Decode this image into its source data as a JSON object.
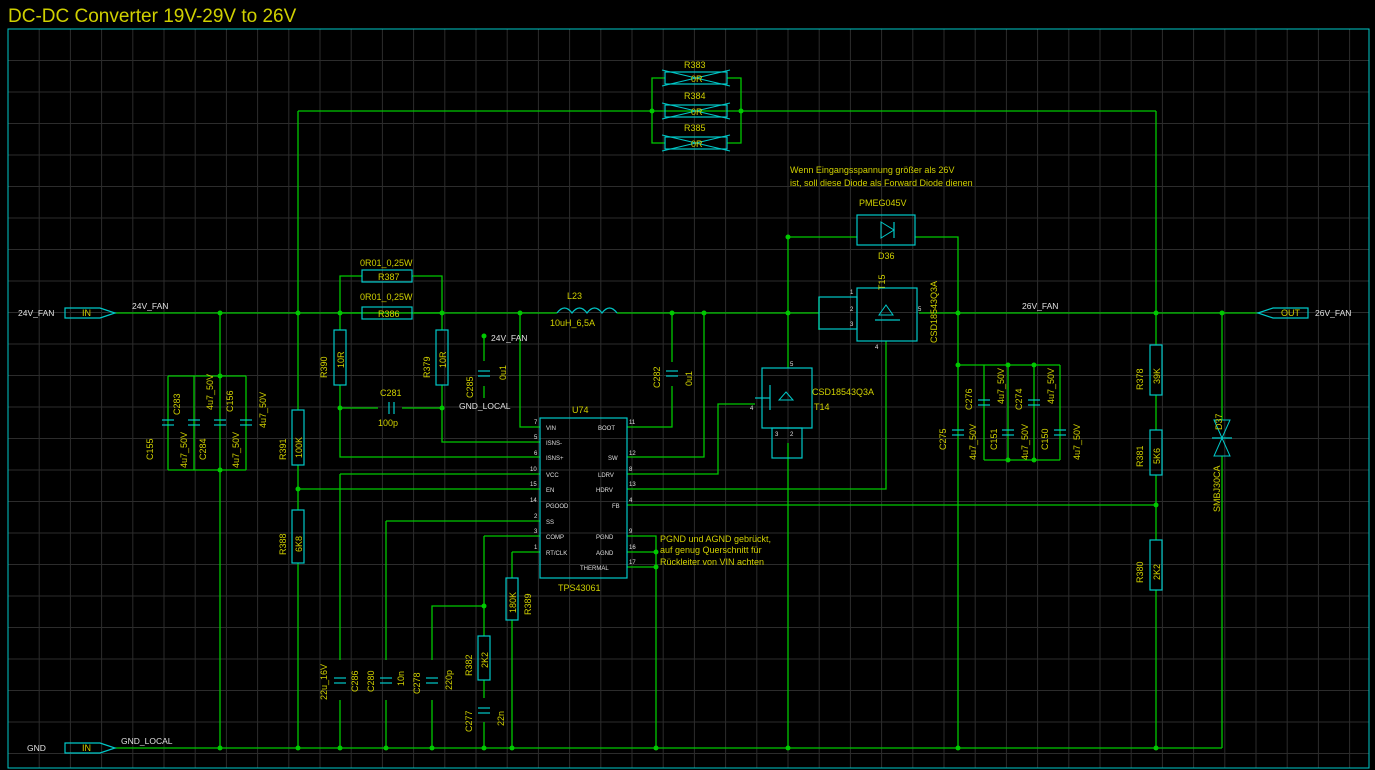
{
  "title": "DC-DC Converter 19V-29V to 26V",
  "ports": {
    "in_24v_tag": "IN",
    "in_24v_name": "24V_FAN",
    "gnd_tag": "IN",
    "gnd_name": "GND",
    "out_26v_tag": "OUT",
    "out_26v_name": "26V_FAN"
  },
  "nets": {
    "n24v_fan": "24V_FAN",
    "gnd_local": "GND_LOCAL",
    "n26v_fan": "26V_FAN"
  },
  "components": {
    "r383": {
      "ref": "R383",
      "value": "0R"
    },
    "r384": {
      "ref": "R384",
      "value": "0R"
    },
    "r385": {
      "ref": "R385",
      "value": "0R"
    },
    "c155": {
      "ref": "C155",
      "value": "4u7_50V"
    },
    "c283": {
      "ref": "C283",
      "value": "4u7_50V"
    },
    "c284": {
      "ref": "C284",
      "value": "4u7_50V"
    },
    "c156": {
      "ref": "C156",
      "value": "4u7_50V"
    },
    "r391": {
      "ref": "R391",
      "value": "100K"
    },
    "r388": {
      "ref": "R388",
      "value": "6K8"
    },
    "r387": {
      "ref": "R387",
      "value": "0R01_0,25W"
    },
    "r386": {
      "ref": "R386",
      "value": "0R01_0,25W"
    },
    "r390": {
      "ref": "R390",
      "value": "10R"
    },
    "r379": {
      "ref": "R379",
      "value": "10R"
    },
    "c281": {
      "ref": "C281",
      "value": "100p"
    },
    "c285": {
      "ref": "C285",
      "value": "0u1"
    },
    "l23": {
      "ref": "L23",
      "value": "10uH_6,5A"
    },
    "c282": {
      "ref": "C282",
      "value": "0u1"
    },
    "u74": {
      "ref": "U74",
      "value": "TPS43061",
      "pins": {
        "vin": "VIN",
        "isns_minus": "ISNS-",
        "isns_plus": "ISNS+",
        "vcc": "VCC",
        "en": "EN",
        "pgood": "PGOOD",
        "ss": "SS",
        "comp": "COMP",
        "rtclk": "RT/CLK",
        "boot": "BOOT",
        "sw": "SW",
        "ldrv": "LDRV",
        "hdrv": "HDRV",
        "fb": "FB",
        "pgnd": "PGND",
        "agnd": "AGND",
        "thermal": "THERMAL"
      },
      "pin_numbers": {
        "7": "7",
        "5": "5",
        "6": "6",
        "10": "10",
        "15": "15",
        "14": "14",
        "2": "2",
        "3": "3",
        "1": "1",
        "11": "11",
        "12": "12",
        "8": "8",
        "13": "13",
        "4": "4",
        "9": "9",
        "16": "16",
        "17": "17"
      }
    },
    "c286": {
      "ref": "C286",
      "value": "22u_16V"
    },
    "c280": {
      "ref": "C280",
      "value": "10n"
    },
    "c278": {
      "ref": "C278",
      "value": "220p"
    },
    "r382": {
      "ref": "R382",
      "value": "2K2"
    },
    "c277": {
      "ref": "C277",
      "value": "22n"
    },
    "r389": {
      "ref": "R389",
      "value": "180K"
    },
    "t14": {
      "ref": "T14",
      "value": "CSD18543Q3A",
      "pins": {
        "4": "4",
        "5": "5",
        "3": "3",
        "2": "2"
      }
    },
    "t15": {
      "ref": "T15",
      "value": "CSD18543Q3A",
      "pins": {
        "1": "1",
        "2": "2",
        "3": "3",
        "5": "5",
        "4": "4"
      }
    },
    "d36": {
      "ref": "D36",
      "value": "PMEG045V"
    },
    "c275": {
      "ref": "C275",
      "value": "4u7_50V"
    },
    "c276": {
      "ref": "C276",
      "value": "4u7_50V"
    },
    "c151": {
      "ref": "C151",
      "value": "4u7_50V"
    },
    "c274": {
      "ref": "C274",
      "value": "4u7_50V"
    },
    "c150": {
      "ref": "C150",
      "value": "4u7_50V"
    },
    "r378": {
      "ref": "R378",
      "value": "39K"
    },
    "r381": {
      "ref": "R381",
      "value": "5K6"
    },
    "r380": {
      "ref": "R380",
      "value": "2K2"
    },
    "d37": {
      "ref": "D37",
      "value": "SMBJ30CA"
    }
  },
  "notes": {
    "pgnd": [
      "PGND und AGND gebrückt,",
      "auf genug Querschnitt für",
      "Rückleiter von VIN achten"
    ],
    "diode": [
      "Wenn Eingangsspannung größer als 26V",
      "ist, soll diese Diode als Forward Diode dienen"
    ]
  },
  "colors": {
    "background": "#000000",
    "grid": "#2c2c2c",
    "wire": "#00c800",
    "symbol": "#00c8c8",
    "label": "#d0d000"
  }
}
